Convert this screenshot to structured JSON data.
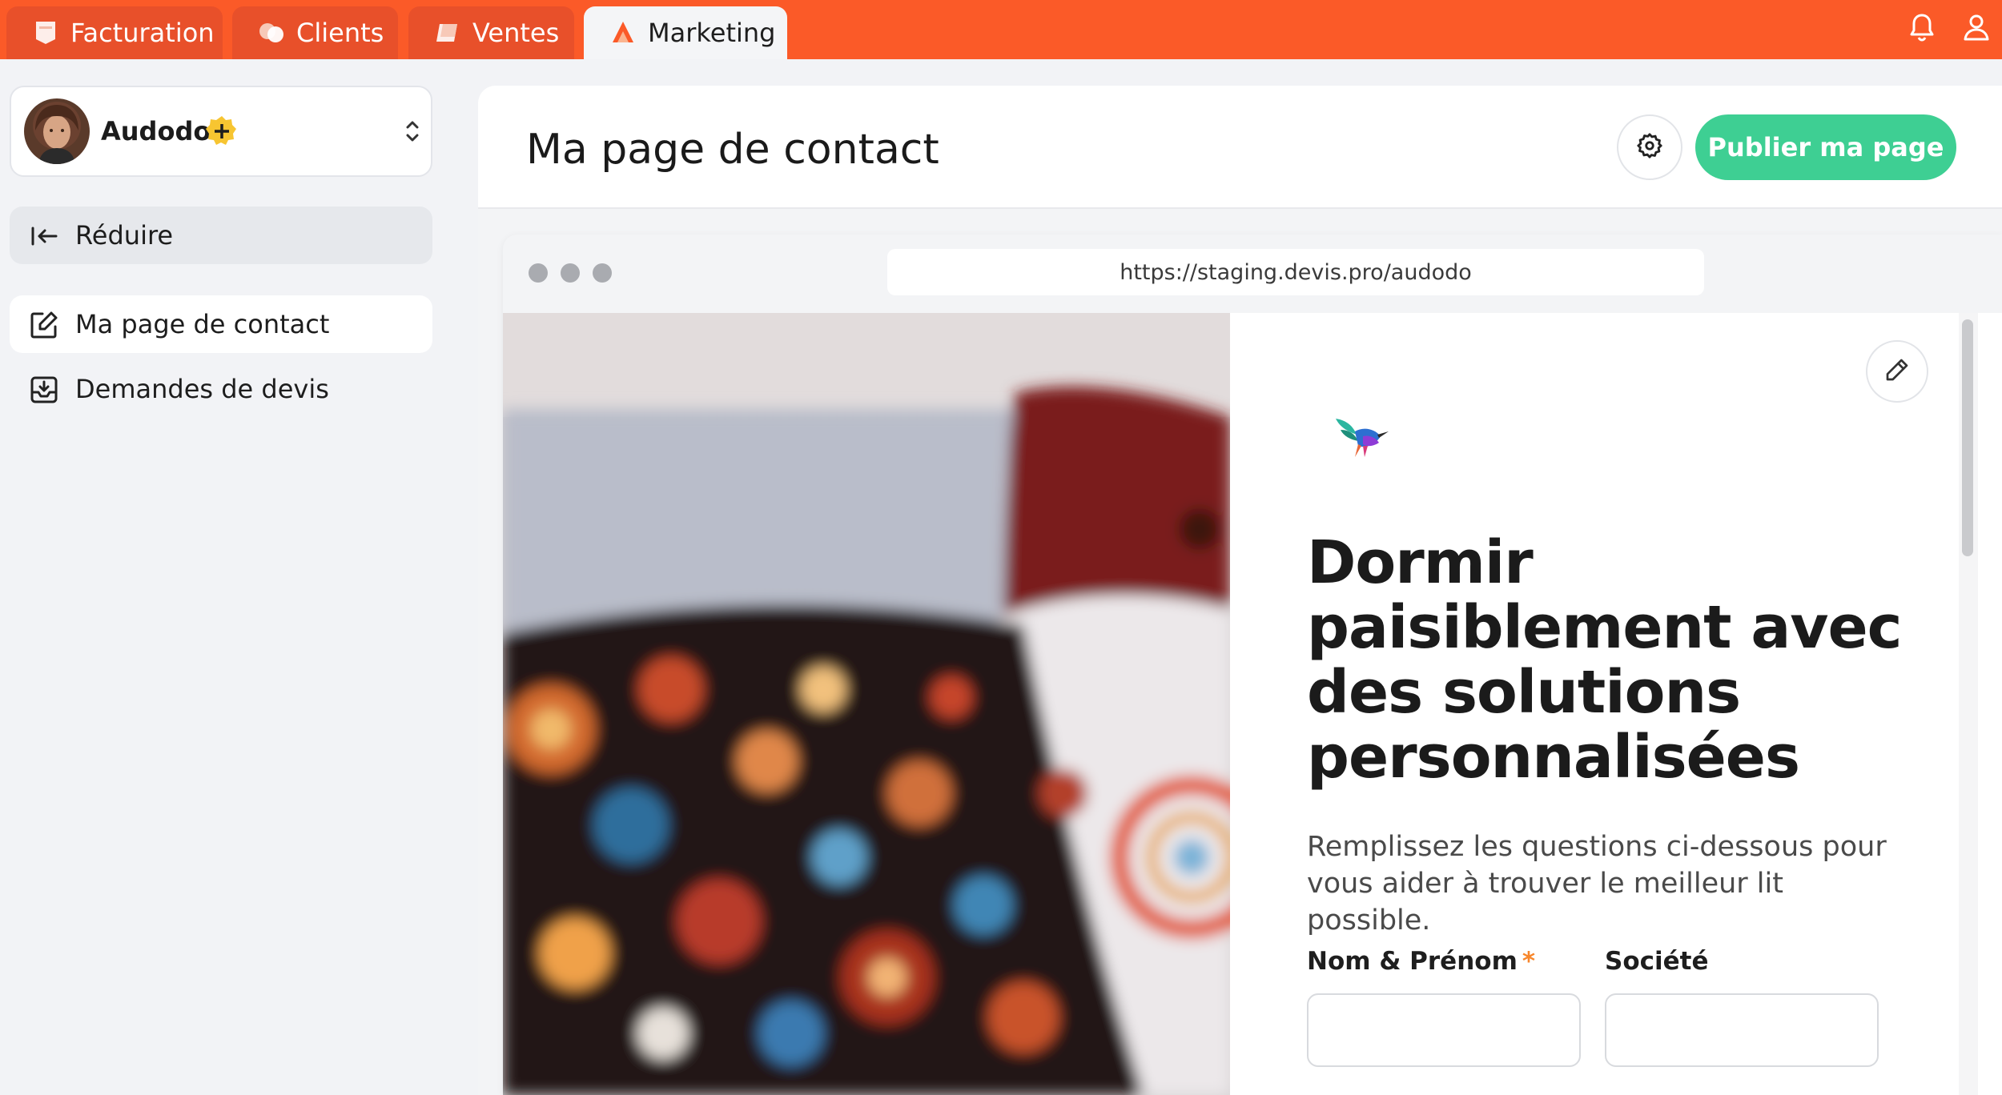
{
  "topbar": {
    "tabs": [
      {
        "label": "Facturation",
        "icon": "invoice-icon",
        "active": false
      },
      {
        "label": "Clients",
        "icon": "clients-icon",
        "active": false
      },
      {
        "label": "Ventes",
        "icon": "sales-icon",
        "active": false
      },
      {
        "label": "Marketing",
        "icon": "marketing-icon",
        "active": true
      }
    ],
    "icons": [
      "bell-icon",
      "user-icon"
    ],
    "color": "#fb5a28"
  },
  "sidebar": {
    "workspace": {
      "name": "Audodo",
      "badge_icon": "plus-badge-icon"
    },
    "collapse_label": "Réduire",
    "items": [
      {
        "label": "Ma page de contact",
        "icon": "edit-page-icon",
        "active": true
      },
      {
        "label": "Demandes de devis",
        "icon": "inbox-icon",
        "active": false
      }
    ]
  },
  "main": {
    "title": "Ma page de contact",
    "publish_label": "Publier ma page",
    "publish_color": "#3ecf93"
  },
  "preview": {
    "url": "https://staging.devis.pro/audodo",
    "headline": "Dormir paisiblement avec des solutions personnalisées",
    "subtext": "Remplissez les questions ci-dessous pour vous aider à trouver le meilleur lit possible.",
    "form": {
      "name_label": "Nom & Prénom",
      "required_mark": "*",
      "company_label": "Société",
      "name_value": "",
      "company_value": ""
    }
  }
}
